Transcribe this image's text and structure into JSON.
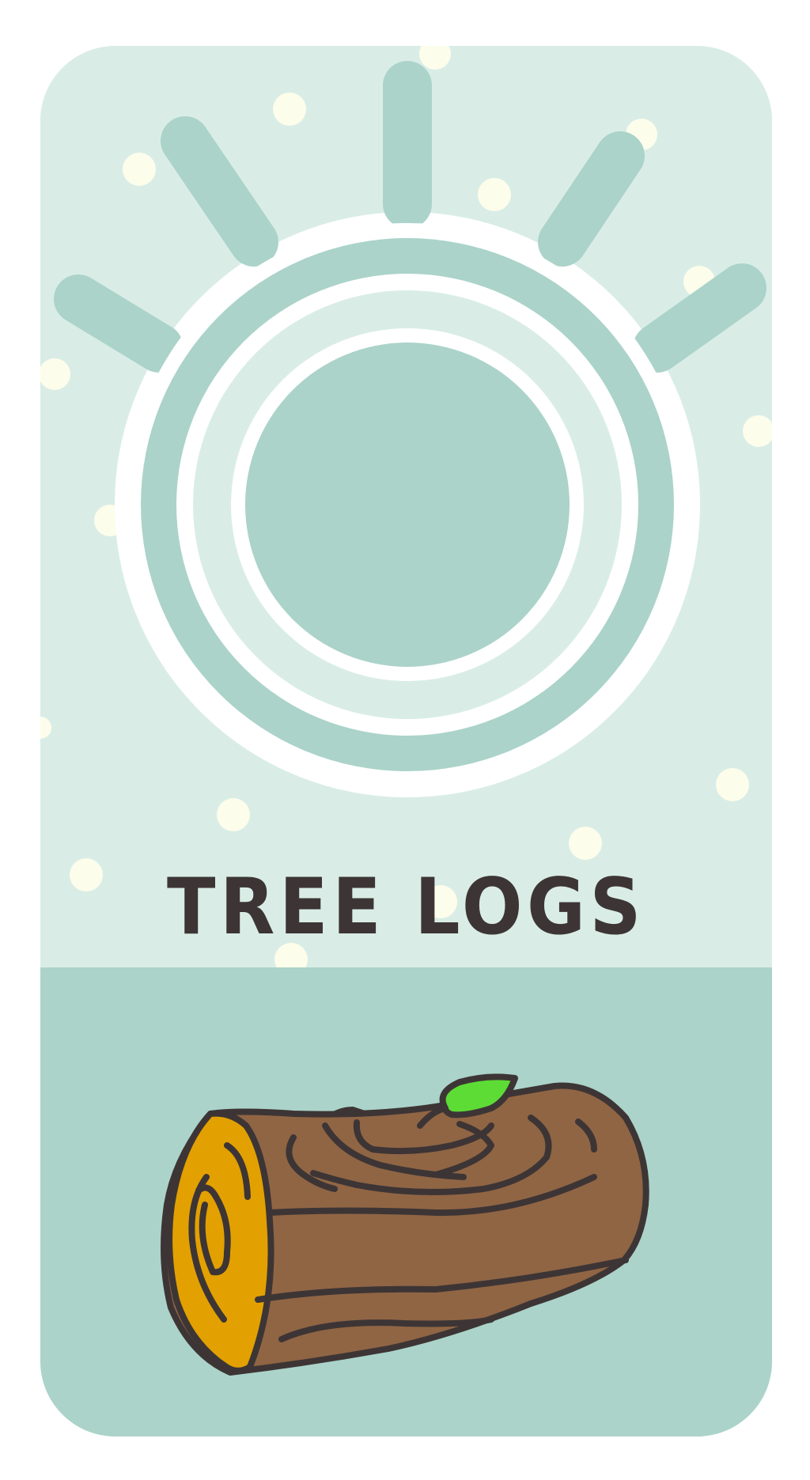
{
  "card": {
    "title": "TREE LOGS",
    "icon": "gear-ring-icon",
    "illustration": "tree-log-icon"
  },
  "colors": {
    "background": "#ffffff",
    "card_top": "#d9ede6",
    "card_bottom": "#abd3c9",
    "emblem_fill": "#abd3c9",
    "emblem_outline": "#ffffff",
    "dots": "#fdfdec",
    "title_text": "#3d3535",
    "log_bark": "#906544",
    "log_core": "#e2a100",
    "log_outline": "#3d3535",
    "leaf": "#5ddc36"
  }
}
